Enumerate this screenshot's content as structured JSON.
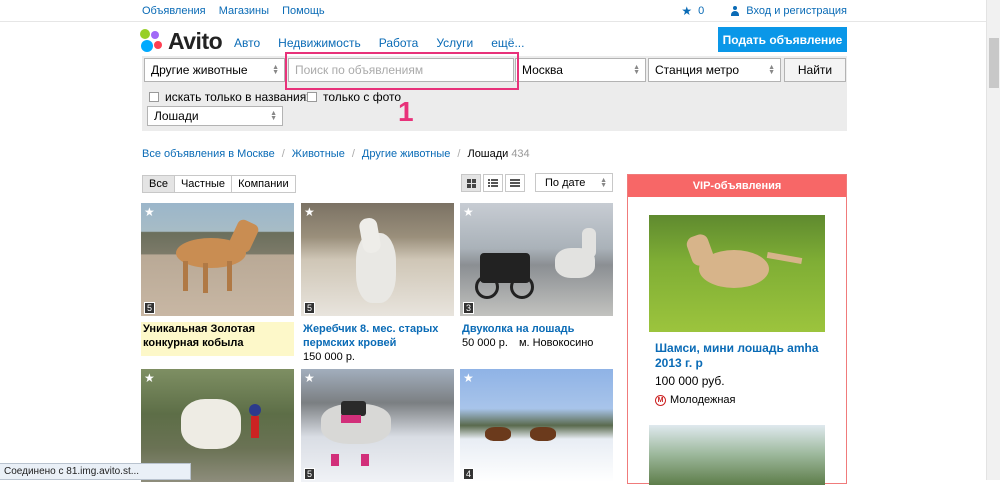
{
  "topbar": {
    "links": [
      "Объявления",
      "Магазины",
      "Помощь"
    ],
    "favorites_count": "0",
    "login": "Вход и регистрация"
  },
  "logo": {
    "text": "Avito"
  },
  "nav": [
    "Авто",
    "Недвижимость",
    "Работа",
    "Услуги",
    "ещё..."
  ],
  "post_button": "Подать объявление",
  "search": {
    "category": "Другие животные",
    "placeholder": "Поиск по объявлениям",
    "city": "Москва",
    "metro": "Станция метро",
    "find_button": "Найти",
    "only_titles": "искать только в названиях",
    "only_photo": "только с фото",
    "subtype": "Лошади"
  },
  "annotation": {
    "number": "1",
    "color": "#e8327a"
  },
  "breadcrumb": {
    "items": [
      "Все объявления в Москве",
      "Животные",
      "Другие животные"
    ],
    "current": "Лошади",
    "count": "434"
  },
  "filters": {
    "tabs": [
      "Все",
      "Частные",
      "Компании"
    ],
    "sort": "По дате"
  },
  "listings": [
    {
      "title": "Уникальная Золотая конкурная кобыла",
      "price": "",
      "metro": "",
      "photos": "5",
      "vip": true
    },
    {
      "title": "Жеребчик 8. мес. старых пермских кровей",
      "price": "150 000 р.",
      "metro": "",
      "photos": "5",
      "vip": false
    },
    {
      "title": "Двуколка на лошадь",
      "price": "50 000 р.",
      "metro": "м. Новокосино",
      "photos": "3",
      "vip": false
    },
    {
      "title": "",
      "price": "",
      "metro": "",
      "photos": "",
      "vip": false
    },
    {
      "title": "",
      "price": "",
      "metro": "",
      "photos": "5",
      "vip": false
    },
    {
      "title": "",
      "price": "",
      "metro": "",
      "photos": "4",
      "vip": false
    }
  ],
  "vip": {
    "header": "VIP-объявления",
    "title": "Шамси, мини лошадь amha 2013 г. р",
    "price": "100 000 руб.",
    "metro_icon": "М",
    "metro": "Молодежная"
  },
  "status": "Соединено с 81.img.avito.st..."
}
